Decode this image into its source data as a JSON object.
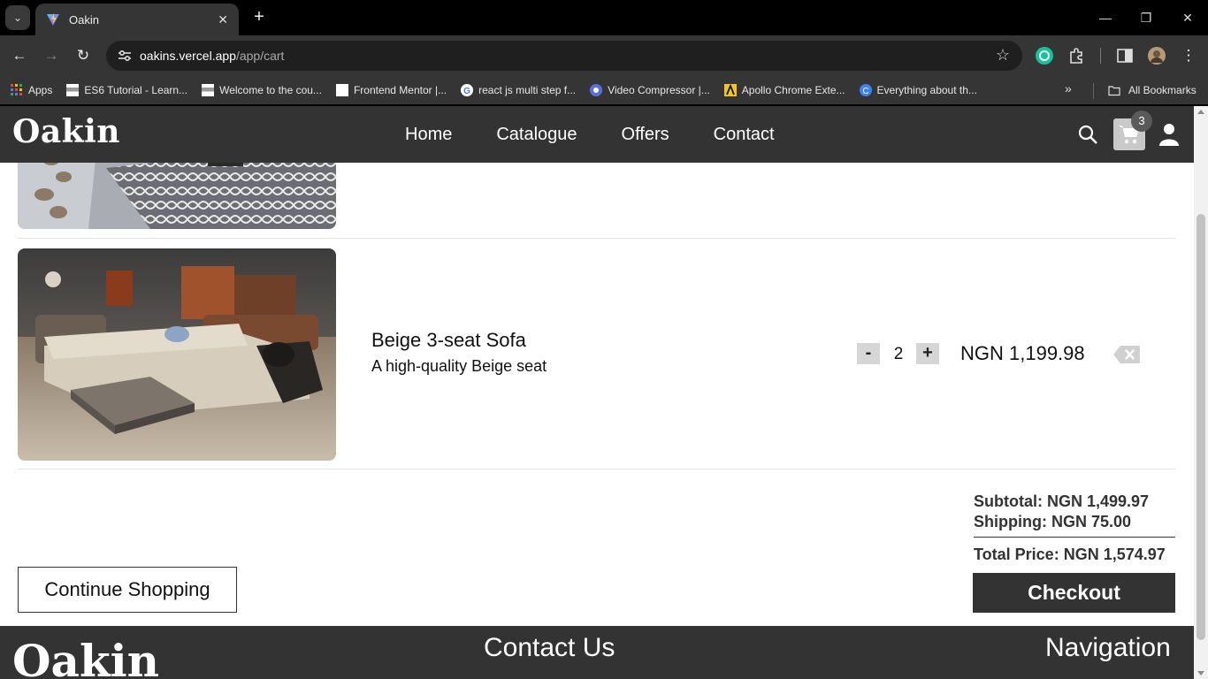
{
  "browser": {
    "tab_title": "Oakin",
    "url_host": "oakins.vercel.app",
    "url_path": "/app/cart",
    "bookmarks": [
      "Apps",
      "ES6 Tutorial - Learn...",
      "Welcome to the cou...",
      "Frontend Mentor |...",
      "react js multi step f...",
      "Video Compressor |...",
      "Apollo Chrome Exte...",
      "Everything about th..."
    ],
    "all_bookmarks": "All Bookmarks"
  },
  "header": {
    "logo": "Oakin",
    "nav": [
      "Home",
      "Catalogue",
      "Offers",
      "Contact"
    ],
    "cart_count": "3"
  },
  "cart": {
    "item": {
      "name": "Beige 3-seat Sofa",
      "description": "A high-quality Beige seat",
      "quantity": "2",
      "price": "NGN 1,199.98",
      "minus_label": "-",
      "plus_label": "+"
    },
    "summary": {
      "subtotal": "Subtotal: NGN 1,499.97",
      "shipping": "Shipping: NGN 75.00",
      "total": "Total Price: NGN 1,574.97"
    },
    "checkout_label": "Checkout",
    "continue_label": "Continue Shopping"
  },
  "footer": {
    "logo": "Oakin",
    "contact_heading": "Contact Us",
    "navigation_heading": "Navigation"
  },
  "colors": {
    "header_bg": "#333333",
    "chrome_bg": "#353535",
    "accent_gray": "#c9c9c9"
  }
}
